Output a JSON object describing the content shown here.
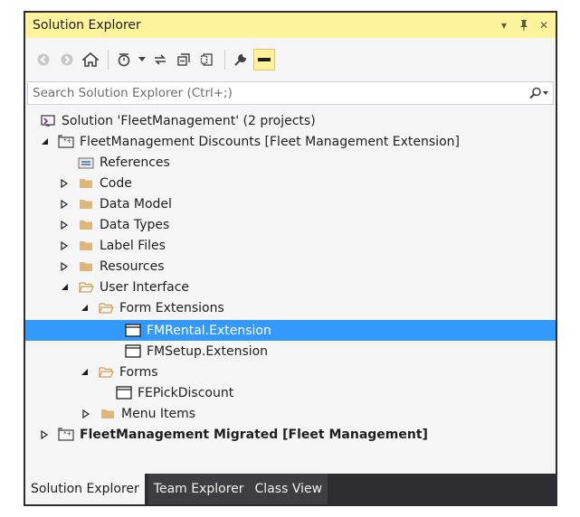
{
  "panel": {
    "title": "Solution Explorer",
    "dropdown_glyph": "▾",
    "pin_glyph": "ᵽ",
    "close_glyph": "✕"
  },
  "search": {
    "placeholder": "Search Solution Explorer (Ctrl+;)"
  },
  "tree": {
    "solution_label": "Solution 'FleetManagement' (2 projects)",
    "items": [
      {
        "label": "FleetManagement Discounts [Fleet Management Extension]",
        "icon": "project-icon",
        "expanded": true
      },
      {
        "label": "References",
        "icon": "references-icon"
      },
      {
        "label": "Code",
        "icon": "folder-icon",
        "expanded": false
      },
      {
        "label": "Data Model",
        "icon": "folder-icon",
        "expanded": false
      },
      {
        "label": "Data Types",
        "icon": "folder-icon",
        "expanded": false
      },
      {
        "label": "Label Files",
        "icon": "folder-icon",
        "expanded": false
      },
      {
        "label": "Resources",
        "icon": "folder-icon",
        "expanded": false
      },
      {
        "label": "User Interface",
        "icon": "folder-open-icon",
        "expanded": true
      },
      {
        "label": "Form Extensions",
        "icon": "folder-open-icon",
        "expanded": true
      },
      {
        "label": "FMRental.Extension",
        "icon": "form-icon",
        "selected": true
      },
      {
        "label": "FMSetup.Extension",
        "icon": "form-icon"
      },
      {
        "label": "Forms",
        "icon": "folder-open-icon",
        "expanded": true
      },
      {
        "label": "FEPickDiscount",
        "icon": "form-icon"
      },
      {
        "label": "Menu Items",
        "icon": "folder-icon",
        "expanded": false
      },
      {
        "label": "FleetManagement Migrated [Fleet Management]",
        "icon": "project-icon",
        "expanded": false,
        "bold": true
      }
    ]
  },
  "tabs": [
    {
      "label": "Solution Explorer",
      "active": true
    },
    {
      "label": "Team Explorer"
    },
    {
      "label": "Class View"
    }
  ],
  "colors": {
    "title_bar": "#fff29d",
    "selection": "#3399ff",
    "folder": "#dcb67a",
    "tab_bar": "#2d2d30"
  }
}
